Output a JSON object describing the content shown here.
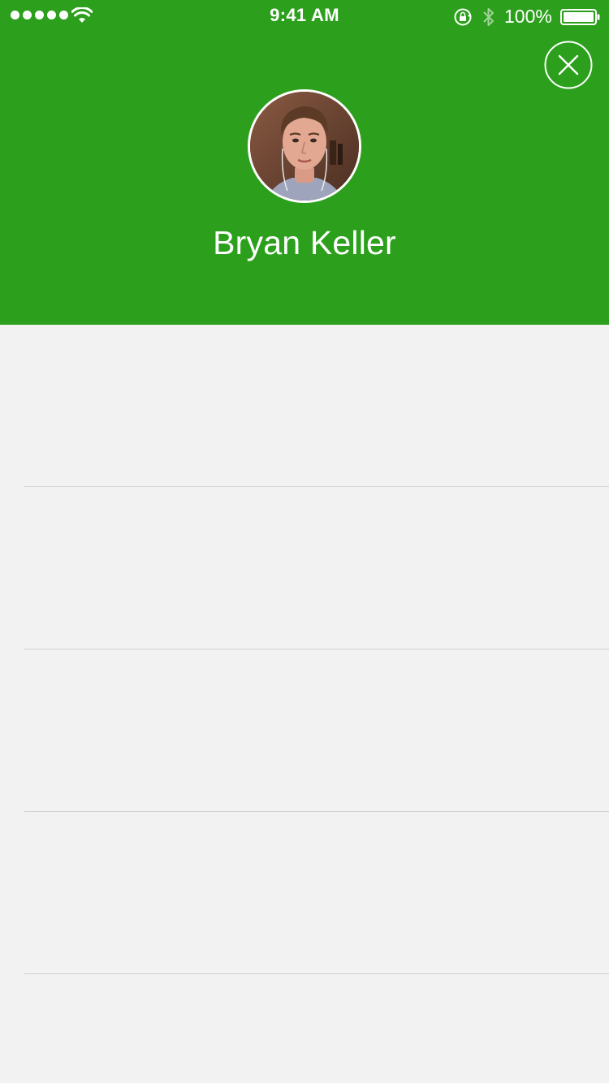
{
  "status_bar": {
    "time": "9:41 AM",
    "battery_percent": "100%",
    "signal_bars": 5
  },
  "header": {
    "background_color": "#2ca01c",
    "close_icon": "close-circle-icon"
  },
  "profile": {
    "name": "Bryan Keller",
    "avatar_icon": "profile-photo"
  },
  "list": {
    "rows": [
      "",
      "",
      "",
      "",
      ""
    ]
  }
}
